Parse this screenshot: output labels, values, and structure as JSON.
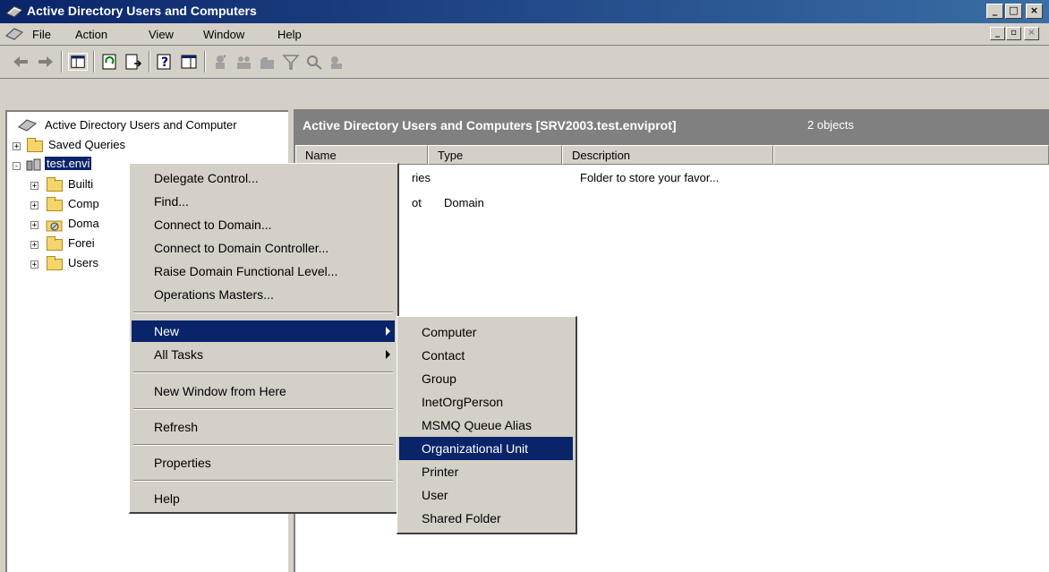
{
  "window": {
    "title": "Active Directory Users and Computers",
    "caption_buttons": [
      "minimize",
      "maximize",
      "close"
    ]
  },
  "menubar": {
    "items": [
      "File",
      "Action",
      "View",
      "Window",
      "Help"
    ]
  },
  "toolbar": {
    "icons": [
      "back-arrow-icon",
      "forward-arrow-icon",
      "show-hide-console-tree-icon",
      "refresh-icon",
      "export-list-icon",
      "help-icon",
      "action-pane-icon",
      "new-user-icon",
      "new-group-icon",
      "new-ou-icon",
      "filter-icon",
      "find-icon",
      "add-to-group-icon"
    ]
  },
  "tree": {
    "root": "Active Directory Users and Computer",
    "items": [
      {
        "label": "Saved Queries"
      },
      {
        "label": "test.envi"
      },
      {
        "label": "Builti"
      },
      {
        "label": "Comp"
      },
      {
        "label": "Doma"
      },
      {
        "label": "Forei"
      },
      {
        "label": "Users"
      }
    ]
  },
  "right": {
    "header_title": "Active Directory Users and Computers [SRV2003.test.enviprot]",
    "header_count": "2 objects",
    "columns": [
      "Name",
      "Type",
      "Description"
    ],
    "rows": [
      {
        "name": "ries",
        "type": "",
        "description": "Folder to store your favor..."
      },
      {
        "name": "ot",
        "type": "Domain",
        "description": ""
      }
    ]
  },
  "context_menu": {
    "items": [
      {
        "label": "Delegate Control..."
      },
      {
        "label": "Find..."
      },
      {
        "label": "Connect to Domain..."
      },
      {
        "label": "Connect to Domain Controller..."
      },
      {
        "label": "Raise Domain Functional Level..."
      },
      {
        "label": "Operations Masters..."
      },
      {
        "label": "New"
      },
      {
        "label": "All Tasks"
      },
      {
        "label": "New Window from Here"
      },
      {
        "label": "Refresh"
      },
      {
        "label": "Properties"
      },
      {
        "label": "Help"
      }
    ]
  },
  "submenu": {
    "items": [
      "Computer",
      "Contact",
      "Group",
      "InetOrgPerson",
      "MSMQ Queue Alias",
      "Organizational Unit",
      "Printer",
      "User",
      "Shared Folder"
    ]
  },
  "colors": {
    "highlight": "#0a246a",
    "face": "#d4d0c8",
    "header_gray": "#808080"
  }
}
